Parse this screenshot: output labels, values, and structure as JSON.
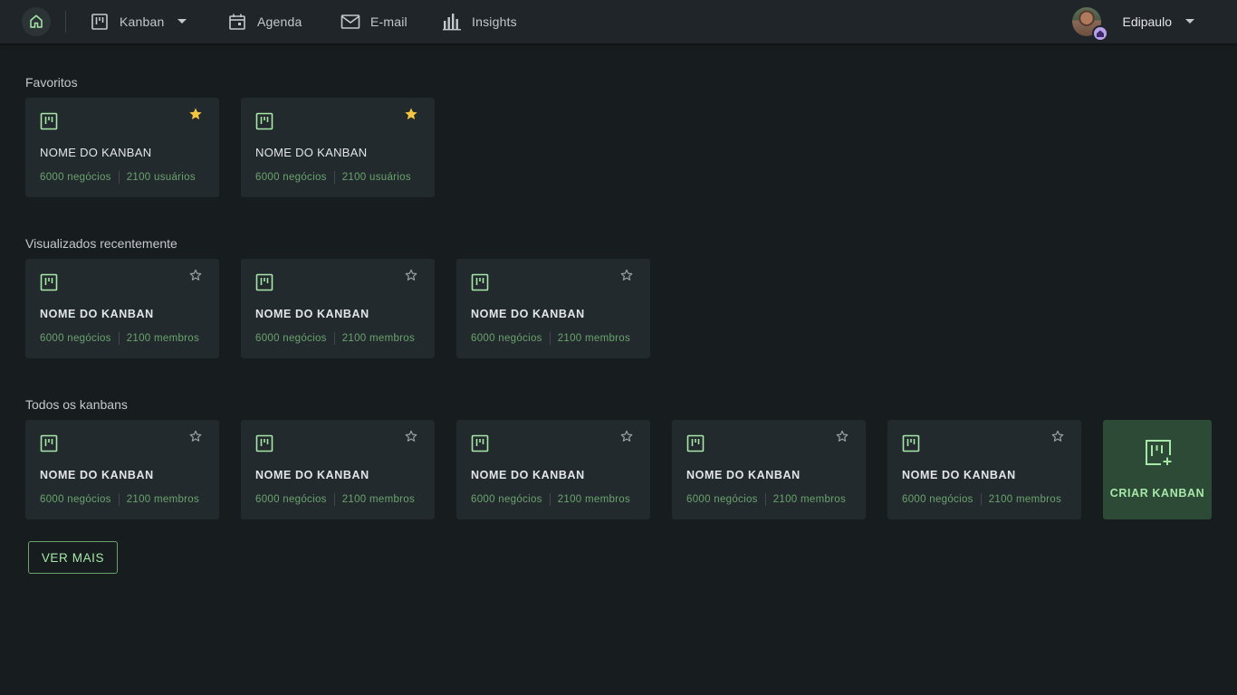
{
  "colors": {
    "background": "#171c1f",
    "topbar": "#1f2528",
    "card": "#222a2d",
    "accent_green": "#a7e8a9",
    "meta_green": "#6ba36e",
    "star_filled": "#f5c542",
    "create_card": "#2c4a35",
    "avatar_badge": "#b9a2ea"
  },
  "nav": {
    "home_icon": "home-icon",
    "items": [
      {
        "label": "Kanban",
        "icon": "kanban-icon",
        "has_dropdown": true
      },
      {
        "label": "Agenda",
        "icon": "calendar-icon"
      },
      {
        "label": "E-mail",
        "icon": "mail-icon"
      },
      {
        "label": "Insights",
        "icon": "bar-chart-icon"
      }
    ]
  },
  "user": {
    "name": "Edipaulo",
    "badge_icon": "house-badge-icon"
  },
  "sections": {
    "favorites": {
      "title": "Favoritos",
      "cards": [
        {
          "name": "NOME DO KANBAN",
          "deals": "6000 negócios",
          "people": "2100 usuários",
          "starred": true
        },
        {
          "name": "NOME DO KANBAN",
          "deals": "6000 negócios",
          "people": "2100 usuários",
          "starred": true
        }
      ]
    },
    "recent": {
      "title": "Visualizados recentemente",
      "cards": [
        {
          "name": "NOME DO KANBAN",
          "deals": "6000 negócios",
          "people": "2100 membros",
          "starred": false
        },
        {
          "name": "NOME DO KANBAN",
          "deals": "6000 negócios",
          "people": "2100 membros",
          "starred": false
        },
        {
          "name": "NOME DO KANBAN",
          "deals": "6000 negócios",
          "people": "2100 membros",
          "starred": false
        }
      ]
    },
    "all": {
      "title": "Todos os kanbans",
      "cards": [
        {
          "name": "NOME DO KANBAN",
          "deals": "6000 negócios",
          "people": "2100 membros",
          "starred": false
        },
        {
          "name": "NOME DO KANBAN",
          "deals": "6000 negócios",
          "people": "2100 membros",
          "starred": false
        },
        {
          "name": "NOME DO KANBAN",
          "deals": "6000 negócios",
          "people": "2100 membros",
          "starred": false
        },
        {
          "name": "NOME DO KANBAN",
          "deals": "6000 negócios",
          "people": "2100 membros",
          "starred": false
        },
        {
          "name": "NOME DO KANBAN",
          "deals": "6000 negócios",
          "people": "2100 membros",
          "starred": false
        }
      ],
      "create_label": "CRIAR KANBAN"
    }
  },
  "ver_mais_label": "VER MAIS"
}
